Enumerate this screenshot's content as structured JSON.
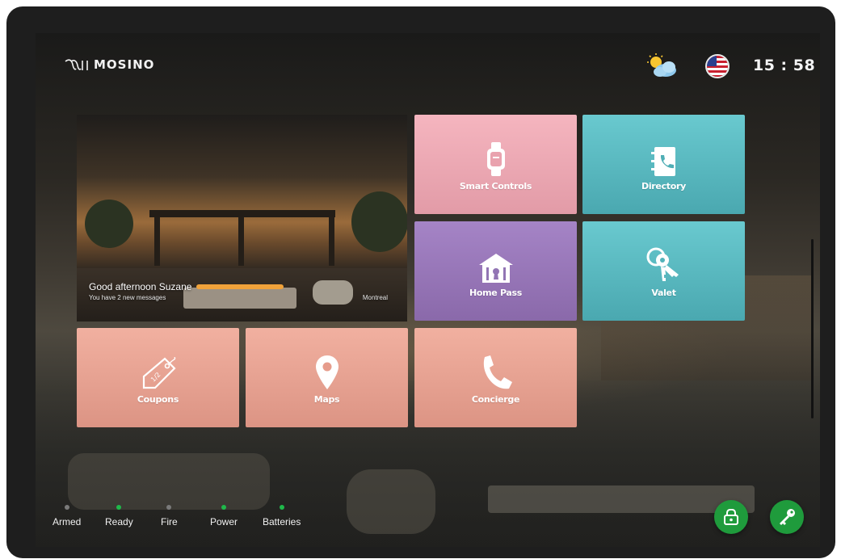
{
  "header": {
    "logo_text": "MOSINO",
    "clock": "15 : 58",
    "weather_icon": "partly-cloudy-icon",
    "language_icon": "us-flag-icon"
  },
  "hero": {
    "greeting": "Good afternoon Suzane",
    "messages": "You have 2 new messages",
    "city": "Montreal"
  },
  "tiles": [
    {
      "label": "Smart Controls",
      "icon": "smartwatch-icon",
      "color": "#f0aab6"
    },
    {
      "label": "Directory",
      "icon": "address-book-phone-icon",
      "color": "#5dbcc3"
    },
    {
      "label": "Home Pass",
      "icon": "home-keyhole-icon",
      "color": "#9a7bbb"
    },
    {
      "label": "Valet",
      "icon": "keys-icon",
      "color": "#5dbcc3"
    },
    {
      "label": "Coupons",
      "icon": "price-tag-icon",
      "color": "#eaa393"
    },
    {
      "label": "Maps",
      "icon": "map-pin-icon",
      "color": "#eaa393"
    },
    {
      "label": "Concierge",
      "icon": "phone-icon",
      "color": "#eaa393"
    }
  ],
  "status": [
    {
      "label": "Armed",
      "active": false
    },
    {
      "label": "Ready",
      "active": true
    },
    {
      "label": "Fire",
      "active": false
    },
    {
      "label": "Power",
      "active": true
    },
    {
      "label": "Batteries",
      "active": true
    }
  ],
  "colors": {
    "status_active": "#1fb84a",
    "status_inactive": "#7a7a7a",
    "action_green": "#1f9b3c"
  },
  "actions": {
    "unlock_icon": "padlock-icon",
    "key_icon": "key-icon"
  }
}
